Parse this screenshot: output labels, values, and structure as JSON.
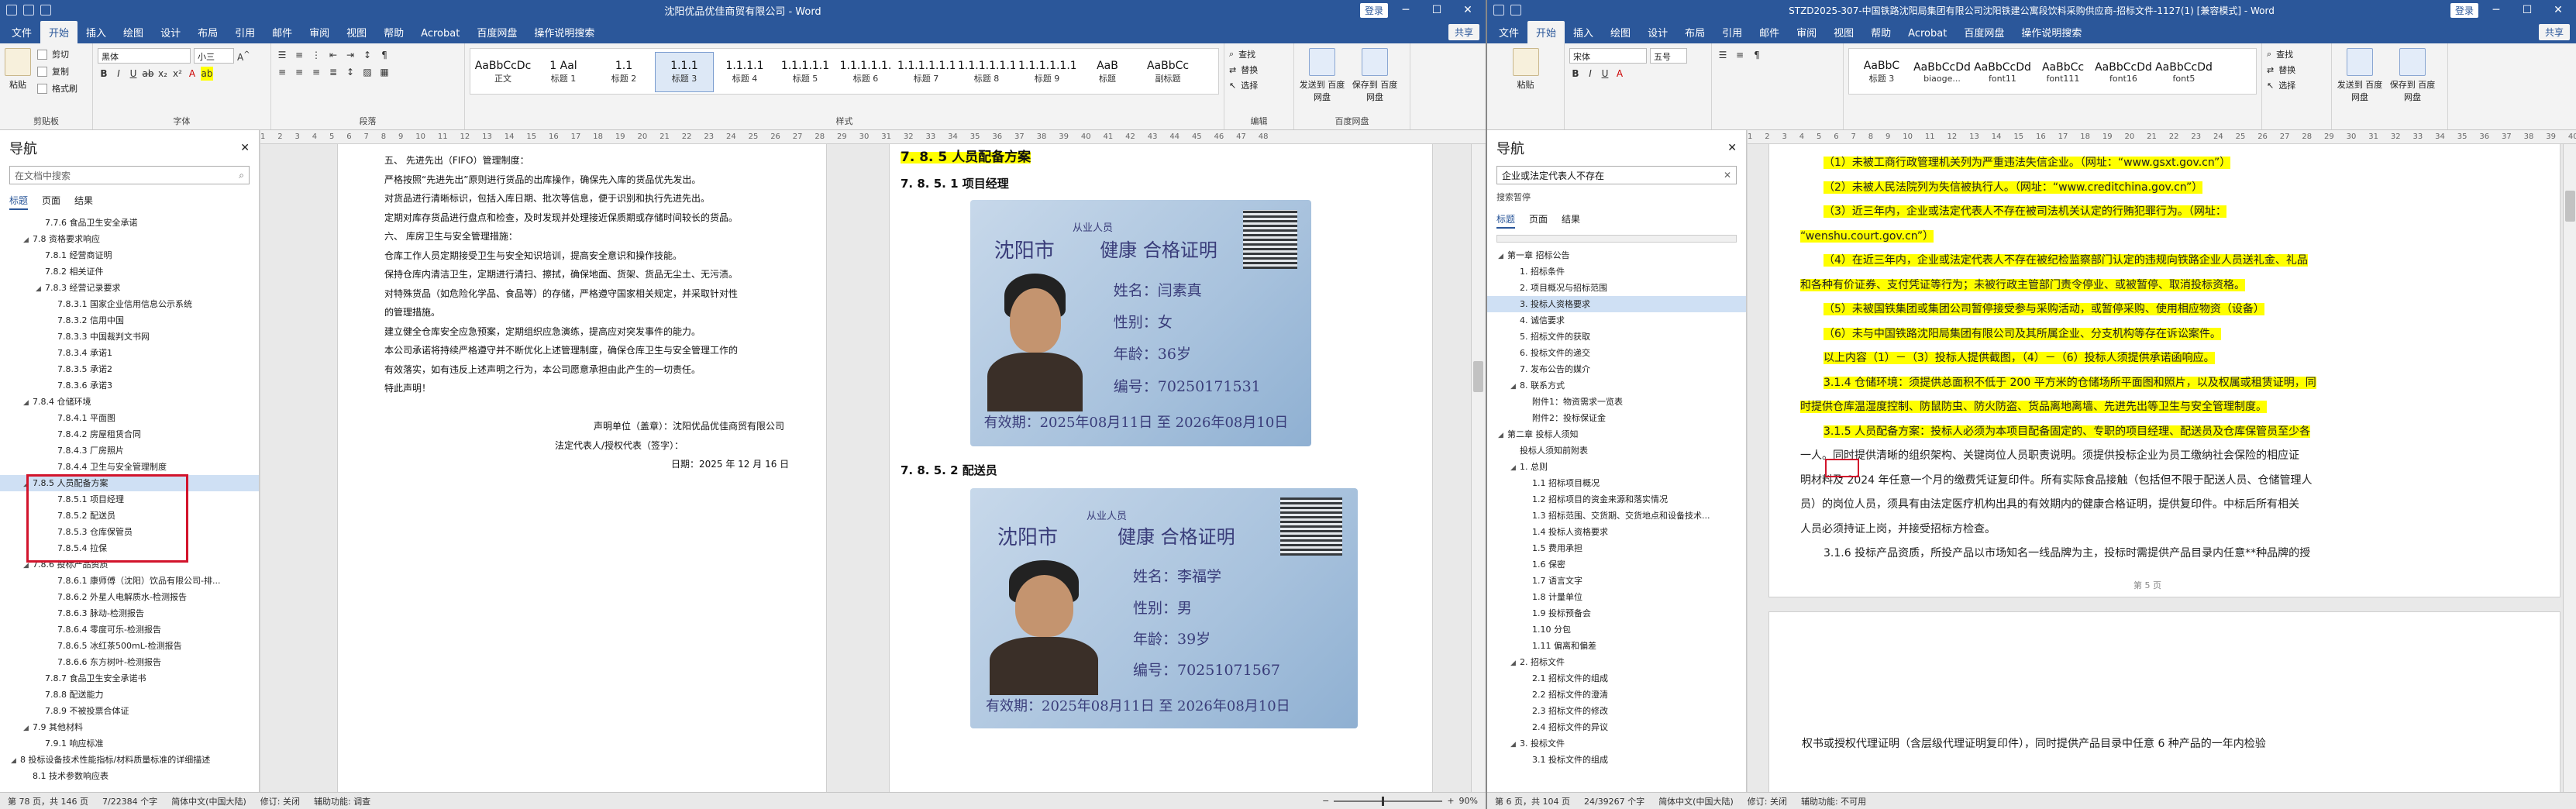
{
  "left": {
    "title": "沈阳优品优佳商贸有限公司 - Word",
    "login": "登录",
    "share": "共享",
    "tabs": [
      "文件",
      "开始",
      "插入",
      "绘图",
      "设计",
      "布局",
      "引用",
      "邮件",
      "审阅",
      "视图",
      "帮助",
      "Acrobat",
      "百度网盘",
      "操作说明搜索"
    ],
    "ribbon": {
      "paste": "粘贴",
      "cut": "剪切",
      "copy": "复制",
      "painter": "格式刷",
      "clipboard": "剪贴板",
      "font_name": "黑体",
      "font_size": "小三",
      "font_group": "字体",
      "para_group": "段落",
      "styles_group": "样式",
      "edit_group": "编辑",
      "find": "查找",
      "replace": "替换",
      "select": "选择",
      "send_label": "发送到 百度网盘",
      "save_label": "保存到 百度网盘",
      "baidu": "百度网盘"
    },
    "styles": [
      {
        "pv": "AaBbCcDc",
        "nm": "正文"
      },
      {
        "pv": "1 Aal",
        "nm": "标题 1"
      },
      {
        "pv": "1.1",
        "nm": "标题 2"
      },
      {
        "pv": "1.1.1",
        "nm": "标题 3"
      },
      {
        "pv": "1.1.1.1",
        "nm": "标题 4"
      },
      {
        "pv": "1.1.1.1.1",
        "nm": "标题 5"
      },
      {
        "pv": "1.1.1.1.1.",
        "nm": "标题 6"
      },
      {
        "pv": "1.1.1.1.1.1",
        "nm": "标题 7"
      },
      {
        "pv": "1.1.1.1.1.1",
        "nm": "标题 8"
      },
      {
        "pv": "1.1.1.1.1.1",
        "nm": "标题 9"
      },
      {
        "pv": "AaB",
        "nm": "标题"
      },
      {
        "pv": "AaBbCc",
        "nm": "副标题"
      }
    ],
    "nav": {
      "title": "导航",
      "search_placeholder": "在文档中搜索",
      "tabs": [
        "标题",
        "页面",
        "结果"
      ],
      "items": [
        {
          "t": "7.7.6 食品卫生安全承诺",
          "lv": 2,
          "ar": ""
        },
        {
          "t": "7.8 资格要求响应",
          "lv": 1,
          "ar": "◢"
        },
        {
          "t": "7.8.1 经营商证明",
          "lv": 2,
          "ar": ""
        },
        {
          "t": "7.8.2 相关证件",
          "lv": 2,
          "ar": ""
        },
        {
          "t": "7.8.3 经营记录要求",
          "lv": 2,
          "ar": "◢"
        },
        {
          "t": "7.8.3.1 国家企业信用信息公示系统",
          "lv": 3,
          "ar": ""
        },
        {
          "t": "7.8.3.2 信用中国",
          "lv": 3,
          "ar": ""
        },
        {
          "t": "7.8.3.3 中国裁判文书网",
          "lv": 3,
          "ar": ""
        },
        {
          "t": "7.8.3.4 承诺1",
          "lv": 3,
          "ar": ""
        },
        {
          "t": "7.8.3.5 承诺2",
          "lv": 3,
          "ar": ""
        },
        {
          "t": "7.8.3.6 承诺3",
          "lv": 3,
          "ar": ""
        },
        {
          "t": "7.8.4 仓储环境",
          "lv": 1,
          "ar": "◢"
        },
        {
          "t": "7.8.4.1 平面图",
          "lv": 3,
          "ar": ""
        },
        {
          "t": "7.8.4.2 房屋租赁合同",
          "lv": 3,
          "ar": ""
        },
        {
          "t": "7.8.4.3 厂房照片",
          "lv": 3,
          "ar": ""
        },
        {
          "t": "7.8.4.4 卫生与安全管理制度",
          "lv": 3,
          "ar": ""
        },
        {
          "t": "7.8.5 人员配备方案",
          "lv": 1,
          "ar": "◢",
          "sel": true
        },
        {
          "t": "7.8.5.1 项目经理",
          "lv": 3,
          "ar": ""
        },
        {
          "t": "7.8.5.2 配送员",
          "lv": 3,
          "ar": ""
        },
        {
          "t": "7.8.5.3 仓库保管员",
          "lv": 3,
          "ar": ""
        },
        {
          "t": "7.8.5.4 拉保",
          "lv": 3,
          "ar": ""
        },
        {
          "t": "7.8.6 投标产品资质",
          "lv": 1,
          "ar": "◢"
        },
        {
          "t": "7.8.6.1 康师傅（沈阳）饮品有限公司-排...",
          "lv": 3,
          "ar": ""
        },
        {
          "t": "7.8.6.2 外星人电解质水-检测报告",
          "lv": 3,
          "ar": ""
        },
        {
          "t": "7.8.6.3 脉动-检测报告",
          "lv": 3,
          "ar": ""
        },
        {
          "t": "7.8.6.4 零度可乐-检测报告",
          "lv": 3,
          "ar": ""
        },
        {
          "t": "7.8.6.5 冰红茶500mL-检测报告",
          "lv": 3,
          "ar": ""
        },
        {
          "t": "7.8.6.6 东方树叶-检测报告",
          "lv": 3,
          "ar": ""
        },
        {
          "t": "7.8.7 食品卫生安全承诺书",
          "lv": 2,
          "ar": ""
        },
        {
          "t": "7.8.8 配送能力",
          "lv": 2,
          "ar": ""
        },
        {
          "t": "7.8.9 不被投票合体证",
          "lv": 2,
          "ar": ""
        },
        {
          "t": "7.9 其他材料",
          "lv": 1,
          "ar": "◢"
        },
        {
          "t": "7.9.1 响应标准",
          "lv": 2,
          "ar": ""
        },
        {
          "t": "8 投标设备技术性能指标/材料质量标准的详细描述",
          "lv": 0,
          "ar": "◢"
        },
        {
          "t": "8.1 技术参数响应表",
          "lv": 1,
          "ar": ""
        }
      ]
    },
    "page1": [
      "五、  先进先出（FIFO）管理制度：",
      "严格按照“先进先出”原则进行货品的出库操作，确保先入库的货品优先发出。",
      "对货品进行清晰标识，包括入库日期、批次等信息，便于识别和执行先进先出。",
      "定期对库存货品进行盘点和检查，及时发现并处理接近保质期或存储时间较长的货品。",
      "六、  库房卫生与安全管理措施：",
      "仓库工作人员定期接受卫生与安全知识培训，提高安全意识和操作技能。",
      "保持仓库内清洁卫生，定期进行清扫、擦拭，确保地面、货架、货品无尘土、无污渍。",
      "对特殊货品（如危险化学品、食品等）的存储，严格遵守国家相关规定，并采取针对性",
      "的管理措施。",
      "建立健全仓库安全应急预案，定期组织应急演练，提高应对突发事件的能力。",
      "本公司承诺将持续严格遵守并不断优化上述管理制度，确保仓库卫生与安全管理工作的",
      "有效落实，如有违反上述声明之行为，本公司愿意承担由此产生的一切责任。",
      "特此声明！",
      "",
      "声明单位（盖章）：沈阳优品优佳商贸有限公司",
      "法定代表人/授权代表（签字）：",
      "日期：2025 年 12 月 16 日"
    ],
    "page2": {
      "heading": "7. 8. 5 人员配备方案",
      "sub1": "7. 8. 5. 1   项目经理",
      "sub2": "7. 8. 5. 2   配送员",
      "card1": {
        "city": "沈阳市",
        "small": "从业人员",
        "cert": "健康 合格证明",
        "name": "姓名：闫素真",
        "sex": "性别：女",
        "age": "年龄：36岁",
        "no": "编号：70250171531",
        "valid": "有效期：2025年08月11日  至  2026年08月10日"
      },
      "card2": {
        "city": "沈阳市",
        "small": "从业人员",
        "cert": "健康 合格证明",
        "name": "姓名：李福学",
        "sex": "性别：男",
        "age": "年龄：39岁",
        "no": "编号：70251071567",
        "valid": "有效期：2025年08月11日  至  2026年08月10日"
      }
    },
    "status": {
      "page": "第 78 页，共 146 页",
      "words": "7/22384 个字",
      "lang": "简体中文(中国大陆)",
      "track": "修订: 关闭",
      "access": "辅助功能: 调查",
      "zoom": "90%"
    }
  },
  "right": {
    "title": "STZD2025-307-中国铁路沈阳局集团有限公司沈阳铁建公寓段饮料采购供应商-招标文件-1127(1) [兼容模式] - Word",
    "login": "登录",
    "share": "共享",
    "tabs": [
      "文件",
      "开始",
      "插入",
      "绘图",
      "设计",
      "布局",
      "引用",
      "邮件",
      "审阅",
      "视图",
      "帮助",
      "Acrobat",
      "百度网盘",
      "操作说明搜索"
    ],
    "ribbon": {
      "font_name": "宋体",
      "font_size": "五号",
      "find": "查找",
      "replace": "替换",
      "select": "选择",
      "send_label": "发送到 百度网盘",
      "save_label": "保存到 百度网盘",
      "paste": "粘贴"
    },
    "styles": [
      {
        "pv": "AaBbC",
        "nm": "标题 3"
      },
      {
        "pv": "AaBbCcDd",
        "nm": "biaoge..."
      },
      {
        "pv": "AaBbCcDd",
        "nm": "font11"
      },
      {
        "pv": "AaBbCc",
        "nm": "font111"
      },
      {
        "pv": "AaBbCcDd",
        "nm": "font16"
      },
      {
        "pv": "AaBbCcDd",
        "nm": "font5"
      }
    ],
    "nav": {
      "title": "导航",
      "search_value": "企业或法定代表人不存在",
      "result_note": "搜索暂停",
      "tabs": [
        "标题",
        "页面",
        "结果"
      ],
      "items": [
        {
          "t": "第一章 招标公告",
          "lv": 0,
          "ar": "◢"
        },
        {
          "t": "1. 招标条件",
          "lv": 1,
          "ar": ""
        },
        {
          "t": "2. 项目概况与招标范围",
          "lv": 1,
          "ar": ""
        },
        {
          "t": "3. 投标人资格要求",
          "lv": 1,
          "ar": "",
          "sel": true
        },
        {
          "t": "4. 诚信要求",
          "lv": 1,
          "ar": ""
        },
        {
          "t": "5. 招标文件的获取",
          "lv": 1,
          "ar": ""
        },
        {
          "t": "6. 投标文件的递交",
          "lv": 1,
          "ar": ""
        },
        {
          "t": "7. 发布公告的媒介",
          "lv": 1,
          "ar": ""
        },
        {
          "t": "8. 联系方式",
          "lv": 1,
          "ar": "◢"
        },
        {
          "t": "附件1：物资需求一览表",
          "lv": 2,
          "ar": ""
        },
        {
          "t": "附件2：投标保证金",
          "lv": 2,
          "ar": ""
        },
        {
          "t": "第二章 投标人须知",
          "lv": 0,
          "ar": "◢"
        },
        {
          "t": "投标人须知前附表",
          "lv": 1,
          "ar": ""
        },
        {
          "t": "1. 总则",
          "lv": 1,
          "ar": "◢"
        },
        {
          "t": "1.1 招标项目概况",
          "lv": 2,
          "ar": ""
        },
        {
          "t": "1.2 招标项目的资金来源和落实情况",
          "lv": 2,
          "ar": ""
        },
        {
          "t": "1.3 招标范围、交货期、交货地点和设备技术...",
          "lv": 2,
          "ar": ""
        },
        {
          "t": "1.4 投标人资格要求",
          "lv": 2,
          "ar": ""
        },
        {
          "t": "1.5 费用承担",
          "lv": 2,
          "ar": ""
        },
        {
          "t": "1.6 保密",
          "lv": 2,
          "ar": ""
        },
        {
          "t": "1.7 语言文字",
          "lv": 2,
          "ar": ""
        },
        {
          "t": "1.8 计量单位",
          "lv": 2,
          "ar": ""
        },
        {
          "t": "1.9 投标预备会",
          "lv": 2,
          "ar": ""
        },
        {
          "t": "1.10 分包",
          "lv": 2,
          "ar": ""
        },
        {
          "t": "1.11 偏离和偏差",
          "lv": 2,
          "ar": ""
        },
        {
          "t": "2. 招标文件",
          "lv": 1,
          "ar": "◢"
        },
        {
          "t": "2.1 招标文件的组成",
          "lv": 2,
          "ar": ""
        },
        {
          "t": "2.2 招标文件的澄清",
          "lv": 2,
          "ar": ""
        },
        {
          "t": "2.3 招标文件的修改",
          "lv": 2,
          "ar": ""
        },
        {
          "t": "2.4 招标文件的异议",
          "lv": 2,
          "ar": ""
        },
        {
          "t": "3. 投标文件",
          "lv": 1,
          "ar": "◢"
        },
        {
          "t": "3.1 投标文件的组成",
          "lv": 2,
          "ar": ""
        }
      ]
    },
    "doc": [
      {
        "t": "（1）未被工商行政管理机关列为严重违法失信企业。（网址：“www.gsxt.gov.cn”）",
        "hl": true,
        "ind": true
      },
      {
        "t": "（2）未被人民法院列为失信被执行人。（网址：“www.creditchina.gov.cn”）",
        "hl": true,
        "ind": true
      },
      {
        "t": "（3）近三年内，企业或法定代表人不存在被司法机关认定的行贿犯罪行为。（网址：",
        "hl": true,
        "ind": true
      },
      {
        "t": "“wenshu.court.gov.cn”）",
        "hl": true,
        "ind": false
      },
      {
        "t": "（4）在近三年内，企业或法定代表人不存在被纪检监察部门认定的违规向铁路企业人员送礼金、礼品",
        "hl": true,
        "ind": true
      },
      {
        "t": "和各种有价证券、支付凭证等行为；未被行政主管部门责令停业、或被暂停、取消投标资格。",
        "hl": true,
        "ind": false
      },
      {
        "t": "（5）未被国铁集团或集团公司暂停接受参与采购活动，或暂停采购、使用相应物资（设备）",
        "hl": true,
        "ind": true
      },
      {
        "t": "（6）未与中国铁路沈阳局集团有限公司及其所属企业、分支机构等存在诉讼案件。",
        "hl": true,
        "ind": true
      },
      {
        "t": "以上内容（1）－（3）投标人提供截图，（4）－（6）投标人须提供承诺函响应。",
        "hl": true,
        "ind": true
      },
      {
        "t": "3.1.4 仓储环境：须提供总面积不低于 200 平方米的仓储场所平面图和照片，以及权属或租赁证明，同",
        "hl": true,
        "ind": true
      },
      {
        "t": "时提供仓库温湿度控制、防鼠防虫、防火防盗、货品离地离墙、先进先出等卫生与安全管理制度。",
        "hl": true,
        "ind": false
      },
      {
        "t": "3.1.5 人员配备方案：投标人必须为本项目配备固定的、专职的项目经理、配送员及仓库保管员至少各",
        "hl": true,
        "ind": true
      },
      {
        "t": "一人。同时提供清晰的组织架构、关键岗位人员职责说明。须提供投标企业为员工缴纳社会保险的相应证",
        "hl": false,
        "ind": false
      },
      {
        "t": "明材料及 2024 年任意一个月的缴费凭证复印件。所有实际食品接触（包括但不限于配送人员、仓储管理人",
        "hl": false,
        "ind": false
      },
      {
        "t": "员）的岗位人员，须具有由法定医疗机构出具的有效期内的健康合格证明，提供复印件。中标后所有相关",
        "hl": false,
        "ind": false
      },
      {
        "t": "人员必须持证上岗，并接受招标方检查。",
        "hl": false,
        "ind": false
      },
      {
        "t": "3.1.6 投标产品资质，所投产品以市场知名一线品牌为主，投标时需提供产品目录内任意**种品牌的授",
        "hl": false,
        "ind": true
      }
    ],
    "page_no": "第 5 页",
    "next_line": "权书或授权代理证明（含层级代理证明复印件），同时提供产品目录中任意 6 种产品的一年内检验",
    "status": {
      "page": "第 6 页，共 104 页",
      "words": "24/39267 个字",
      "lang": "简体中文(中国大陆)",
      "track": "修订: 关闭",
      "access": "辅助功能: 不可用"
    }
  }
}
